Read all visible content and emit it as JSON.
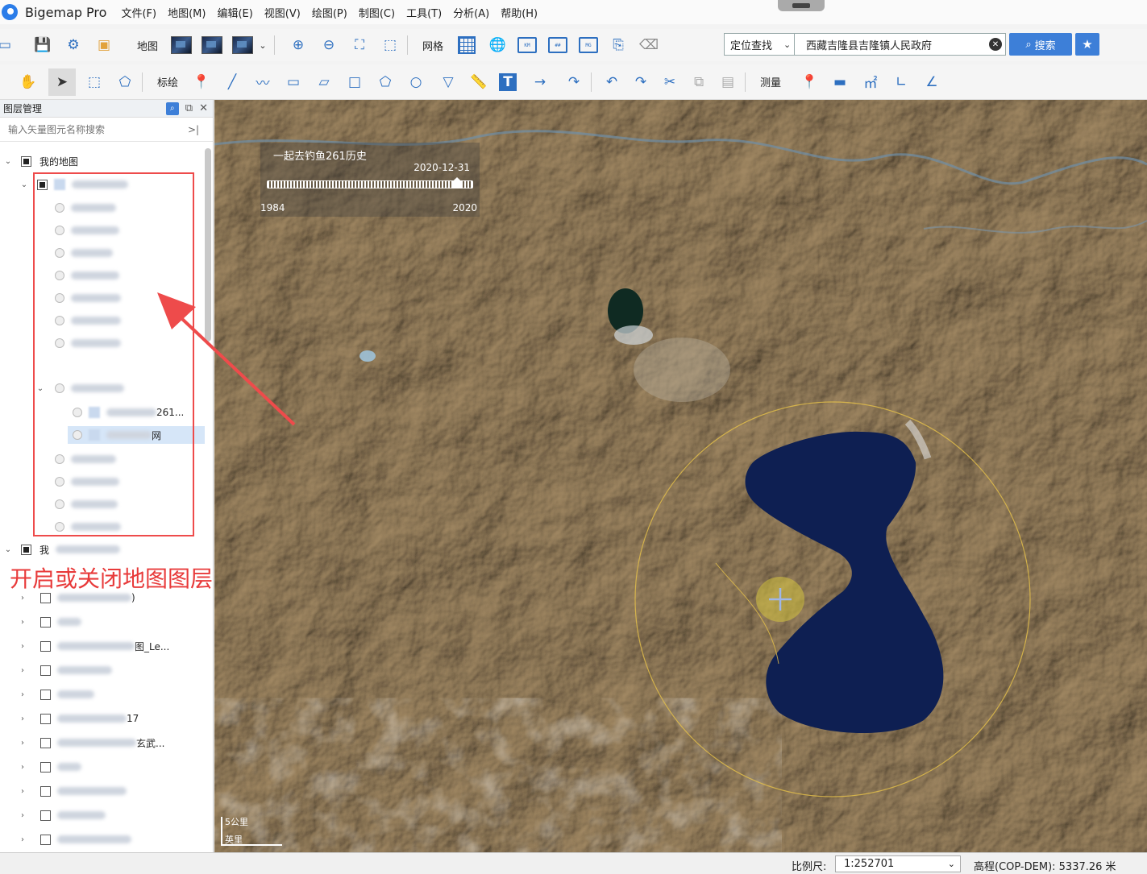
{
  "app": {
    "title": "Bigemap Pro"
  },
  "menu": [
    "文件(F)",
    "地图(M)",
    "编辑(E)",
    "视图(V)",
    "绘图(P)",
    "制图(C)",
    "工具(T)",
    "分析(A)",
    "帮助(H)"
  ],
  "toolbar1": {
    "map_label": "地图",
    "grid_label": "网格",
    "search_mode": "定位查找",
    "search_value": "西藏吉隆县吉隆镇人民政府",
    "search_button": "搜索"
  },
  "toolbar2": {
    "annotate_label": "标绘",
    "measure_label": "测量",
    "text_tool": "T"
  },
  "panel": {
    "title": "图层管理",
    "search_placeholder": "输入矢量图元名称搜索",
    "root_label": "我的地图",
    "item_26l": "261...",
    "item_net": "网",
    "second_root_prefix": "我",
    "lower_items": [
      ")",
      "",
      "图_Le...",
      "",
      "",
      "17",
      "玄武...",
      "",
      "",
      "",
      ""
    ]
  },
  "annotation_text": "开启或关闭地图图层",
  "timeline": {
    "title": "一起去钓鱼261历史",
    "current_date": "2020-12-31",
    "start_year": "1984",
    "end_year": "2020"
  },
  "scalebar": {
    "km": "5公里",
    "mi": "英里"
  },
  "status": {
    "scale_label": "比例尺:",
    "scale_value": "1:252701",
    "elevation": "高程(COP-DEM): 5337.26 米"
  },
  "colors": {
    "accent": "#3d7fd8",
    "annotation_red": "#e83a3a",
    "lake": "#0e1f52"
  }
}
